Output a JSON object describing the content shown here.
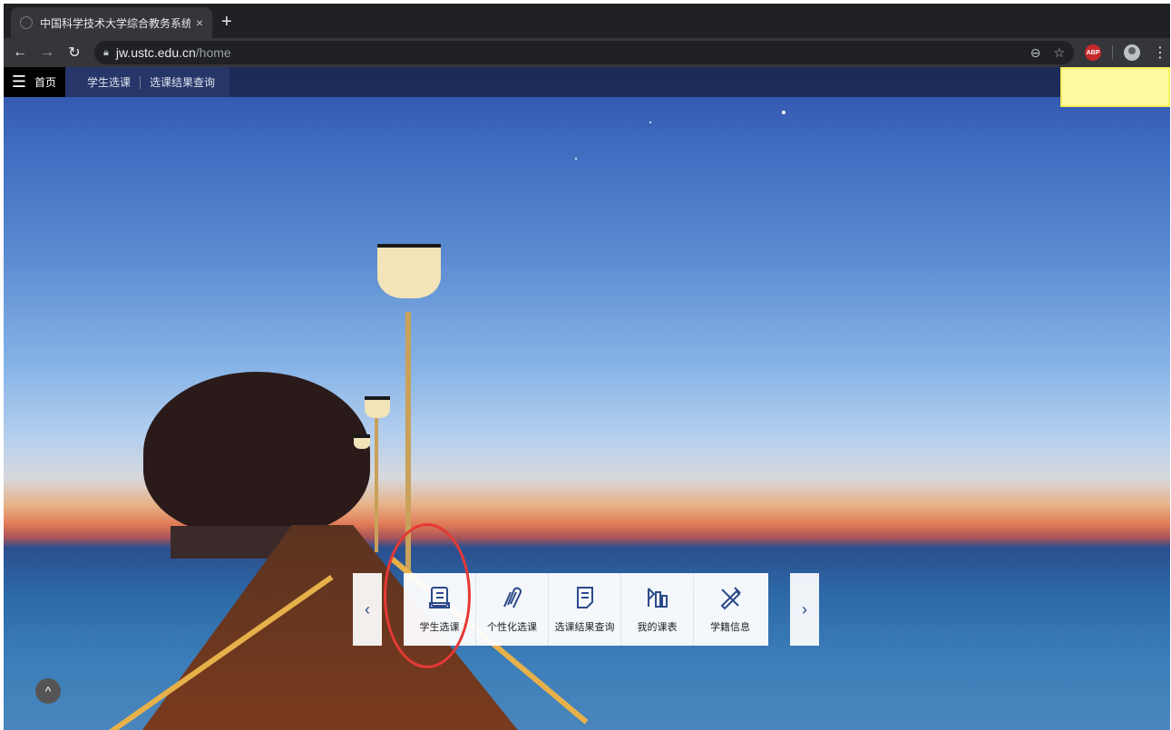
{
  "browser": {
    "tab_title": "中国科学技术大学综合教务系统",
    "tab_close": "×",
    "new_tab": "+",
    "url_host": "jw.ustc.edu.cn",
    "url_path": "/home",
    "extension_badge": "ABP"
  },
  "site_nav": {
    "home_label": "首页",
    "tabs": [
      {
        "label": "学生选课"
      },
      {
        "label": "选课结果查询"
      }
    ]
  },
  "dock": {
    "prev_label": "‹",
    "next_label": "›",
    "items": [
      {
        "label": "学生选课",
        "icon": "course-select-icon"
      },
      {
        "label": "个性化选课",
        "icon": "paperclip-icon"
      },
      {
        "label": "选课结果查询",
        "icon": "document-icon"
      },
      {
        "label": "我的课表",
        "icon": "schedule-icon"
      },
      {
        "label": "学籍信息",
        "icon": "pencil-ruler-icon"
      }
    ]
  },
  "back_to_top": "^",
  "colors": {
    "accent": "#2b4a8a",
    "annotation_circle": "#e53935",
    "highlight": "#fffaa0"
  }
}
